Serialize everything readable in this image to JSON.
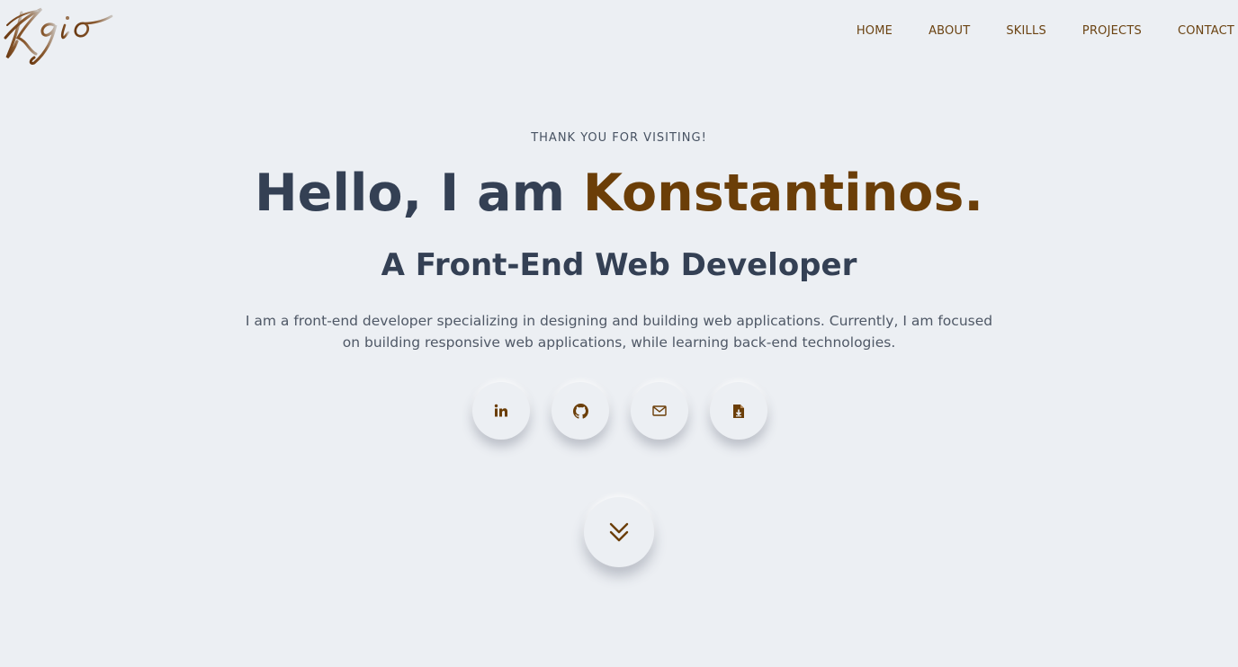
{
  "header": {
    "logo": {
      "text": "Kgio",
      "icon": "kgio-signature-logo"
    },
    "nav": [
      {
        "label": "HOME"
      },
      {
        "label": "ABOUT"
      },
      {
        "label": "SKILLS"
      },
      {
        "label": "PROJECTS"
      },
      {
        "label": "CONTACT"
      }
    ]
  },
  "hero": {
    "eyebrow": "THANK YOU FOR VISITING!",
    "greeting": "Hello, I am ",
    "name": "Konstantinos.",
    "role": "A Front-End Web Developer",
    "bio": "I am a front-end developer specializing in designing and building web applications. Currently, I am focused on building responsive web applications, while learning back-end technologies.",
    "socials": [
      {
        "icon": "linkedin-icon"
      },
      {
        "icon": "github-icon"
      },
      {
        "icon": "mail-icon"
      },
      {
        "icon": "download-resume-icon"
      }
    ],
    "scroll": {
      "icon": "chevron-double-down-icon"
    }
  },
  "colors": {
    "background": "#eceff3",
    "accent": "#6b3e08",
    "heading": "#344054",
    "nav_text": "#6b4312"
  }
}
